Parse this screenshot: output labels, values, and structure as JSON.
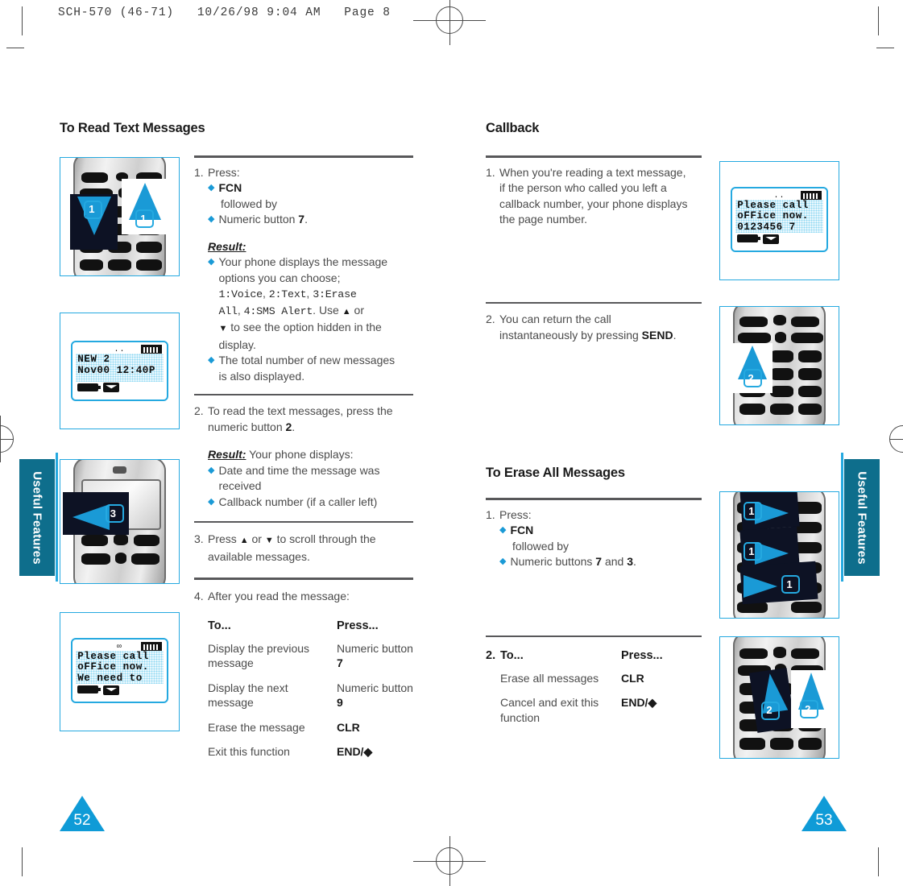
{
  "print_header": "SCH-570 (46-71)   10/26/98 9:04 AM   Page 8",
  "side_tab_label": "Useful Features",
  "page_numbers": {
    "left": "52",
    "right": "53"
  },
  "left_column": {
    "heading": "To Read Text Messages",
    "step1": {
      "num": "1.",
      "lead": "Press:",
      "bullet1_bold": "FCN",
      "bullet1_sub": "followed by",
      "bullet2_pre": "Numeric button ",
      "bullet2_bold": "7",
      "bullet2_post": ".",
      "result_label": "Result:",
      "result_b1_line1": "Your phone displays the message",
      "result_b1_line2": "options you can choose;",
      "result_mono_1": "1:Voice",
      "result_sep_1": ", ",
      "result_mono_2": "2:Text",
      "result_sep_2": ", ",
      "result_mono_3": "3:Erase",
      "result_mono_4": "All",
      "result_sep_3": ", ",
      "result_mono_5": "4:SMS Alert",
      "result_after": ". Use ",
      "up_arrow": "▲",
      "or_text": " or",
      "down_arrow": "▼",
      "result_tail_1": " to see the option hidden in the",
      "result_tail_2": "display.",
      "result_b2_line1": "The total number of new messages",
      "result_b2_line2": "is also displayed."
    },
    "step2": {
      "num": "2.",
      "line1": "To read the text messages, press the",
      "line2_pre": "numeric button ",
      "line2_bold": "2",
      "line2_post": ".",
      "result_label": "Result:",
      "result_lead": " Your phone displays:",
      "b1_line1": "Date and time the message was",
      "b1_line2": "received",
      "b2": "Callback number (if a caller left)"
    },
    "step3": {
      "num": "3.",
      "pre": "Press ",
      "up_arrow": "▲",
      "mid": " or ",
      "down_arrow": "▼",
      "post": " to scroll through the",
      "line2": "available messages."
    },
    "step4": {
      "num": "4.",
      "lead": "After you read the message:"
    },
    "press_table": {
      "col1_header": "To...",
      "col2_header": "Press...",
      "rows": [
        {
          "to": "Display the previous message",
          "press_pre": "Numeric button ",
          "press_bold": "7",
          "press_post": ""
        },
        {
          "to": "Display the next message",
          "press_pre": "Numeric button ",
          "press_bold": "9",
          "press_post": ""
        },
        {
          "to": "Erase the message",
          "press_pre": "",
          "press_bold": "CLR",
          "press_post": ""
        },
        {
          "to": "Exit this function",
          "press_pre": "",
          "press_bold": "END/",
          "press_post": "◆"
        }
      ]
    },
    "figures": [
      {
        "name": "keypad-fcn-7",
        "callout_numbers": [
          "1",
          "1"
        ]
      },
      {
        "name": "lcd-new-messages",
        "lcd_lines": [
          "  NEW  2",
          "Nov00 12:40P"
        ]
      },
      {
        "name": "phone-scroll-keys",
        "callout_numbers": [
          "3"
        ]
      },
      {
        "name": "lcd-message-text",
        "lcd_lines": [
          "Please call",
          "oFFice now.",
          "We need to"
        ]
      }
    ]
  },
  "right_column": {
    "heading1": "Callback",
    "cb_step1": {
      "num": "1.",
      "line1": "When you're reading a text message,",
      "line2": "if the person who called you left a",
      "line3": "callback number, your phone displays",
      "line4": "the page number."
    },
    "cb_step2": {
      "num": "2.",
      "line1": "You can return the call",
      "line2_pre": "instantaneously by pressing ",
      "line2_bold": "SEND",
      "line2_post": "."
    },
    "heading2": "To Erase All Messages",
    "er_step1": {
      "num": "1.",
      "lead": "Press:",
      "bullet1_bold": "FCN",
      "bullet1_sub": "followed by",
      "bullet2_pre": "Numeric buttons ",
      "bullet2_bold1": "7",
      "bullet2_mid": " and ",
      "bullet2_bold2": "3",
      "bullet2_post": "."
    },
    "press_table": {
      "num": "2.",
      "col1_header": "To...",
      "col2_header": "Press...",
      "rows": [
        {
          "to": "Erase all messages",
          "press_bold": "CLR",
          "press_post": ""
        },
        {
          "to": "Cancel and exit this function",
          "press_bold": "END/",
          "press_post": "◆"
        }
      ]
    },
    "figures": [
      {
        "name": "lcd-callback-number",
        "lcd_lines": [
          "Please call",
          "oFFice now.",
          "0123456 7"
        ]
      },
      {
        "name": "keypad-send-key",
        "callout_numbers": [
          "2"
        ]
      },
      {
        "name": "keypad-fcn-7-3",
        "callout_numbers": [
          "1",
          "1",
          "1"
        ]
      },
      {
        "name": "keypad-clr-end",
        "callout_numbers": [
          "2",
          "2"
        ]
      }
    ]
  },
  "colors": {
    "accent_cyan": "#25a9e0",
    "tab_teal": "#0e6e8c",
    "page_triangle": "#0f9bd7",
    "rule_gray": "#58585a",
    "body_text": "#4b4b4b"
  }
}
